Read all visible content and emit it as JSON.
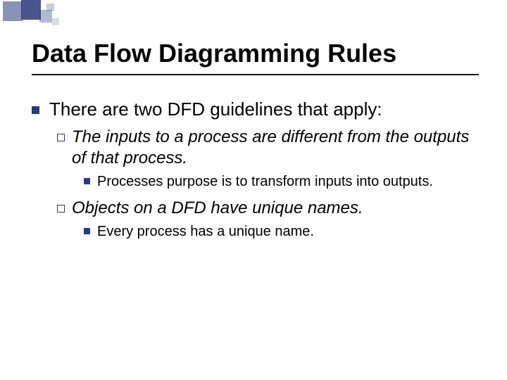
{
  "title": "Data Flow Diagramming Rules",
  "main": {
    "text": "There are two DFD guidelines that apply:"
  },
  "sub": [
    {
      "text": "The inputs to a process are different from the outputs of that process.",
      "children": [
        {
          "text": "Processes purpose is to transform inputs into outputs."
        }
      ]
    },
    {
      "text": "Objects on a DFD have unique names.",
      "children": [
        {
          "text": "Every process has a unique name."
        }
      ]
    }
  ]
}
